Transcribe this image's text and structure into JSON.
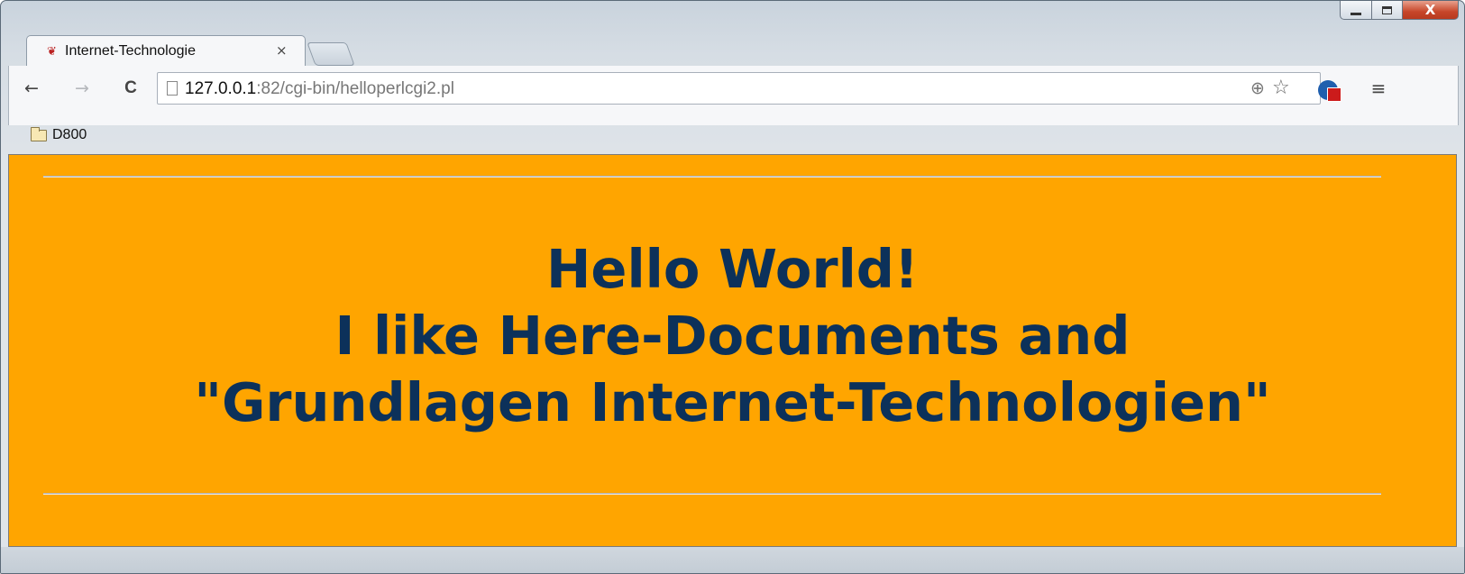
{
  "window": {
    "caption_buttons": {
      "minimize_icon": "minimize-icon",
      "maximize_icon": "maximize-icon",
      "close_label": "X"
    }
  },
  "tabs": [
    {
      "title": "Internet-Technologie",
      "favicon": "tree-favicon-icon",
      "close_label": "×",
      "active": true
    }
  ],
  "toolbar": {
    "back_icon": "←",
    "forward_icon": "→",
    "reload_icon": "C",
    "url_host": "127.0.0.1",
    "url_rest": ":82/cgi-bin/helloperlcgi2.pl",
    "zoom_icon": "⊕",
    "bookmark_star_icon": "☆",
    "menu_icon": "≡"
  },
  "bookmarks": [
    {
      "label": "D800",
      "icon": "folder-icon"
    }
  ],
  "page": {
    "background_color": "#FFA500",
    "text_color": "#0c315a",
    "heading_lines": [
      "Hello World!",
      "I like Here-Documents and",
      "\"Grundlagen Internet-Technologien\""
    ]
  }
}
